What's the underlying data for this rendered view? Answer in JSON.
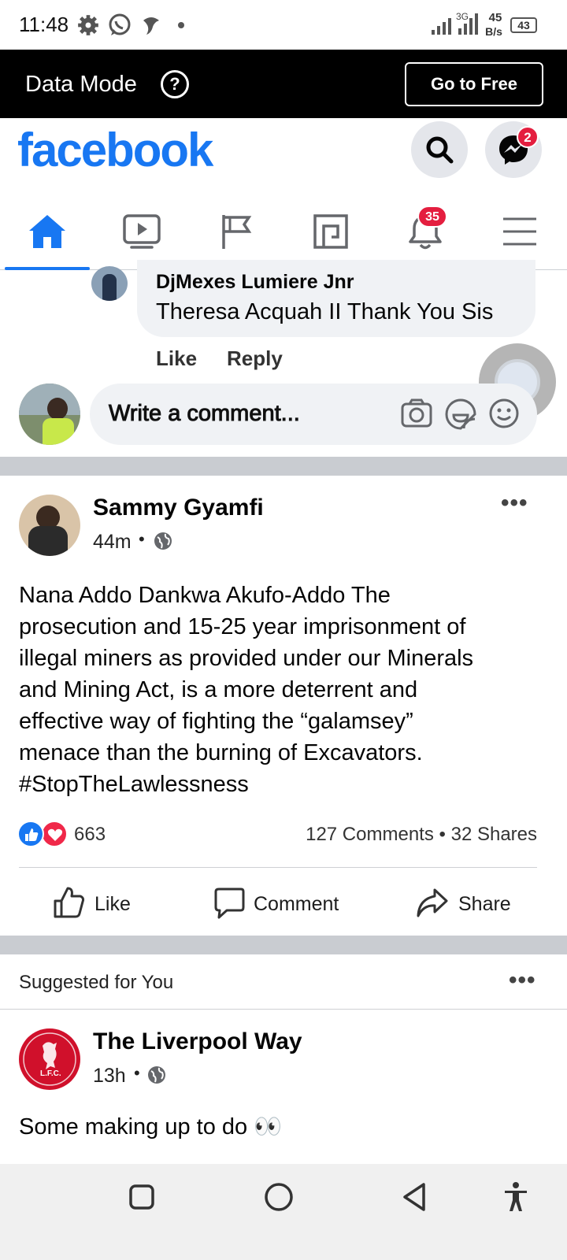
{
  "status_bar": {
    "time": "11:48",
    "network_type": "3G",
    "speed_value": "45",
    "speed_unit": "B/s",
    "battery": "43",
    "icons": [
      "gear-icon",
      "whatsapp-icon",
      "app-icon",
      "dot-icon",
      "signal-icon",
      "battery-icon"
    ]
  },
  "data_mode_bar": {
    "label": "Data Mode",
    "help_glyph": "?",
    "go_free_label": "Go to Free"
  },
  "header": {
    "logo": "facebook",
    "messenger_badge": "2"
  },
  "tabs": {
    "active_index": 0,
    "items": [
      "home",
      "watch",
      "pages",
      "marketplace",
      "notifications",
      "menu"
    ],
    "notifications_badge": "35"
  },
  "comment": {
    "author": "DjMexes Lumiere Jnr",
    "text": "Theresa Acquah II Thank You Sis",
    "like_label": "Like",
    "reply_label": "Reply"
  },
  "composer": {
    "placeholder": "Write a comment..."
  },
  "post": {
    "author": "Sammy Gyamfi",
    "time": "44m",
    "text_lines": [
      "Nana Addo Dankwa Akufo-Addo The",
      "prosecution and 15-25 year imprisonment of",
      "illegal miners as provided under our Minerals",
      "and Mining Act, is a more deterrent and",
      "effective way of fighting the “galamsey”",
      "menace than the burning of Excavators.",
      "#StopTheLawlessness"
    ],
    "reaction_count": "663",
    "comments_count": "127 Comments",
    "shares_count": "32 Shares",
    "separator": "•",
    "actions": {
      "like": "Like",
      "comment": "Comment",
      "share": "Share"
    }
  },
  "suggested": {
    "heading": "Suggested for You",
    "author": "The Liverpool Way",
    "time": "13h",
    "text": "Some making up to do 👀",
    "logo_text": "L.F.C."
  },
  "colors": {
    "brand": "#1877f2",
    "badge": "#e41e3f",
    "bubble": "#f0f2f5",
    "liverpool_red": "#d0102b"
  }
}
